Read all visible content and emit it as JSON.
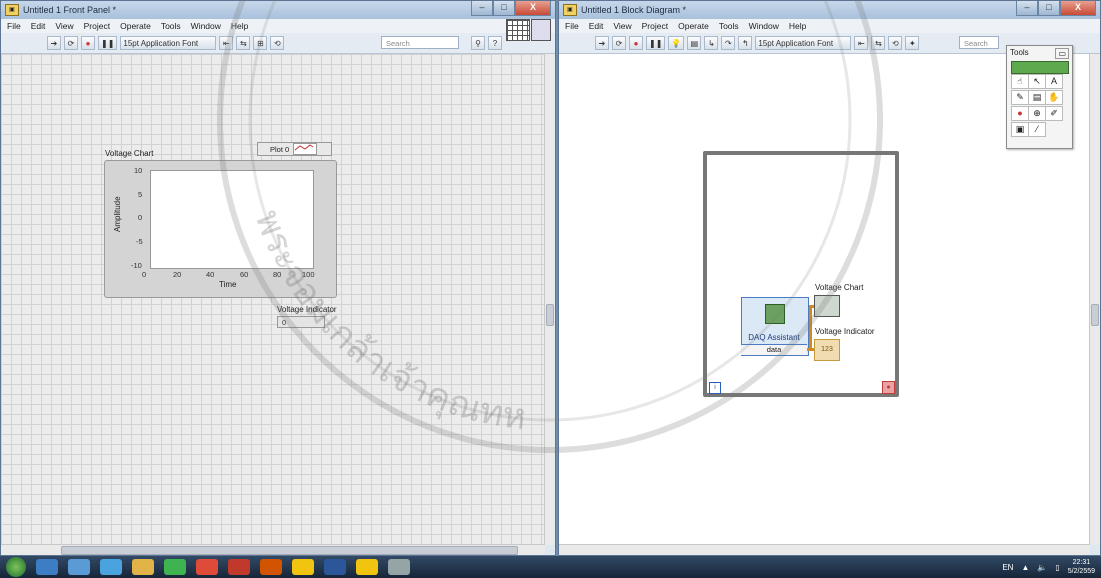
{
  "front_panel": {
    "title": "Untitled 1 Front Panel *",
    "menu": [
      "File",
      "Edit",
      "View",
      "Project",
      "Operate",
      "Tools",
      "Window",
      "Help"
    ],
    "font_selector": "15pt Application Font",
    "search_placeholder": "Search",
    "chart": {
      "label": "Voltage Chart",
      "legend_plot": "Plot 0",
      "ylabel": "Amplitude",
      "xlabel": "Time",
      "y_ticks": [
        "10",
        "5",
        "0",
        "-5",
        "-10"
      ],
      "x_ticks": [
        "0",
        "20",
        "40",
        "60",
        "80",
        "100"
      ]
    },
    "indicator": {
      "label": "Voltage Indicator",
      "value": "0"
    }
  },
  "block_diagram": {
    "title": "Untitled 1 Block Diagram *",
    "menu": [
      "File",
      "Edit",
      "View",
      "Project",
      "Operate",
      "Tools",
      "Window",
      "Help"
    ],
    "font_selector": "15pt Application Font",
    "search_placeholder": "Search",
    "daq": {
      "label": "DAQ Assistant",
      "output": "data"
    },
    "chart_terminal": "Voltage Chart",
    "indicator_terminal": "Voltage Indicator",
    "indicator_dtype": "123",
    "iteration_label": "i",
    "tools_palette_title": "Tools"
  },
  "window_controls": {
    "minimize": "–",
    "maximize": "□",
    "close": "X"
  },
  "taskbar": {
    "apps": [
      {
        "name": "chrome-alt-icon",
        "color": "#3c7dc4"
      },
      {
        "name": "bird-icon",
        "color": "#5b9bd5"
      },
      {
        "name": "skype-icon",
        "color": "#4aa3df"
      },
      {
        "name": "explorer-icon",
        "color": "#e2b347"
      },
      {
        "name": "line-icon",
        "color": "#3fb34f"
      },
      {
        "name": "chrome-icon",
        "color": "#de4b39"
      },
      {
        "name": "filezilla-icon",
        "color": "#c0392b"
      },
      {
        "name": "media-icon",
        "color": "#d35400"
      },
      {
        "name": "labview-icon",
        "color": "#f1c40f"
      },
      {
        "name": "word-icon",
        "color": "#2b579a"
      },
      {
        "name": "labview2-icon",
        "color": "#f1c40f"
      },
      {
        "name": "signal-icon",
        "color": "#95a5a6"
      }
    ],
    "language": "EN",
    "time": "22:31",
    "date": "5/2/2559"
  },
  "watermark_text": "พระจอมเกล้าเจ้าคุณทห"
}
